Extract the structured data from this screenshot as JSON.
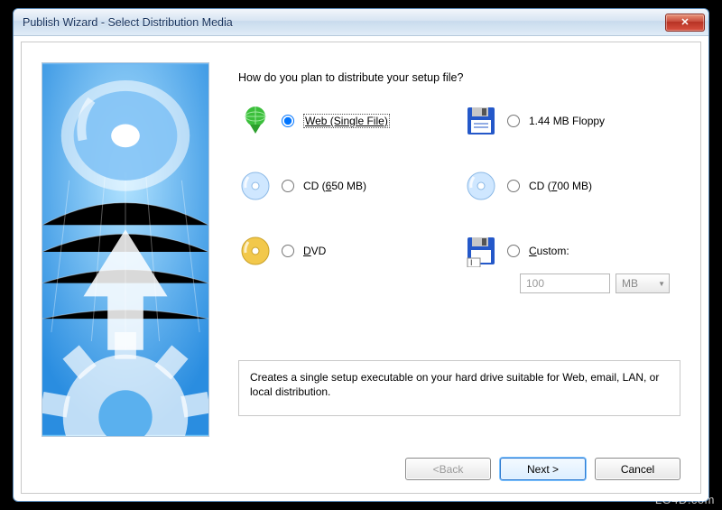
{
  "window": {
    "title": "Publish Wizard - Select Distribution Media"
  },
  "question": "How do you plan to distribute your setup file?",
  "options": {
    "web": {
      "label": "Web (Single File)",
      "selected": true
    },
    "floppy": {
      "label": "1.44 MB Floppy"
    },
    "cd650": {
      "label": "CD (650 MB)",
      "underline_idx": 4
    },
    "cd700": {
      "label": "CD (700 MB)",
      "underline_idx": 4
    },
    "dvd": {
      "label": "DVD"
    },
    "custom": {
      "label": "Custom:",
      "value": "100",
      "unit": "MB"
    }
  },
  "description": "Creates a single setup executable on your hard drive suitable for Web, email, LAN, or local distribution.",
  "buttons": {
    "back": "< Back",
    "next": "Next >",
    "cancel": "Cancel"
  },
  "watermark": "LO4D.com"
}
